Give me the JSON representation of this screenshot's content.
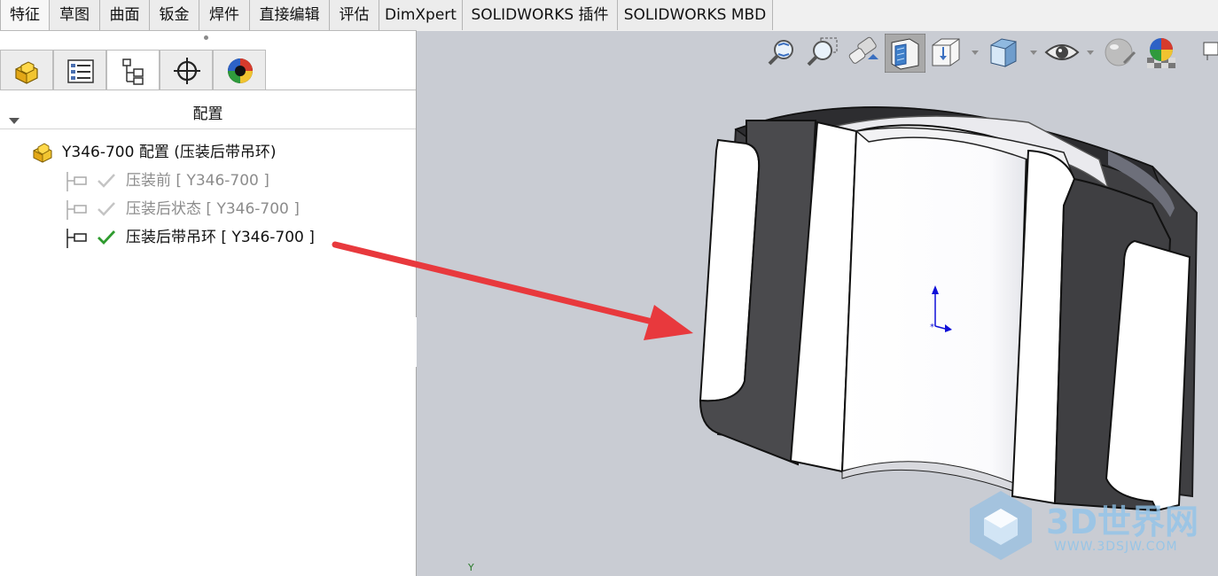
{
  "ribbon": {
    "tabs": [
      {
        "label": "特征",
        "active": true
      },
      {
        "label": "草图"
      },
      {
        "label": "曲面"
      },
      {
        "label": "钣金"
      },
      {
        "label": "焊件"
      },
      {
        "label": "直接编辑"
      },
      {
        "label": "评估"
      },
      {
        "label": "DimXpert"
      },
      {
        "label": "SOLIDWORKS 插件"
      },
      {
        "label": "SOLIDWORKS MBD"
      }
    ]
  },
  "panel": {
    "tabs": [
      "feature-manager",
      "property-manager",
      "configuration-manager",
      "dimxpert-manager",
      "display-manager"
    ],
    "active_tab": "configuration-manager",
    "title": "配置",
    "tree": {
      "root": "Y346-700 配置 (压装后带吊环)",
      "configs": [
        {
          "label": "压装前 [ Y346-700 ]",
          "active": false
        },
        {
          "label": "压装后状态 [ Y346-700 ]",
          "active": false
        },
        {
          "label": "压装后带吊环 [ Y346-700 ]",
          "active": true
        }
      ]
    }
  },
  "viewport": {
    "toolbar": [
      "zoom-to-fit",
      "zoom-to-area",
      "previous-view",
      "section-view",
      "view-orientation",
      "display-style",
      "hide-show-items",
      "edit-appearance",
      "apply-scene",
      "view-settings"
    ],
    "triad_label": "Y",
    "watermark": {
      "text": "3D世界网",
      "url": "WWW.3DSJW.COM"
    }
  },
  "colors": {
    "accent_arrow": "#e8393d",
    "active_check": "#2e9b2e",
    "inactive_text": "#8c8c8c",
    "viewport_bg": "#c9ccd3"
  }
}
